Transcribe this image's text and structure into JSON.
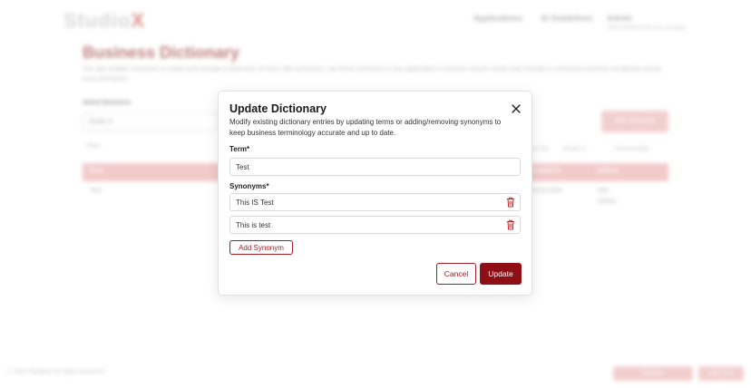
{
  "background": {
    "logo_text": "Studio",
    "logo_x": "X",
    "nav": [
      "Applications",
      "AI Guidelines",
      "Admin"
    ],
    "user_sub": "someone@domain.com manage",
    "page_title": "Business Dictionary",
    "page_desc": "The app enables everyone to create and manage a dictionary of terms with synonyms, use these synonyms in any application to improve search results and maintain a consistent business vocabulary across tools and teams.",
    "select_label": "Select Business",
    "select_value": "Studio X",
    "add_button": "Add Dictionary",
    "filter_text": "Filter",
    "sort_by": "Sort By",
    "sort_value": "Studio X",
    "sort_order": "Descending",
    "table_headers": [
      "Term",
      "Created At",
      "Actions"
    ],
    "row": {
      "term": "Test",
      "created": "01/01/2024",
      "action1": "Edit",
      "action2": "Delete"
    },
    "footer": "© 2024 StudioX All rights reserved.",
    "footer_btn1": "Explore",
    "footer_btn2": "Sign Out"
  },
  "modal": {
    "title": "Update Dictionary",
    "description": "Modify existing dictionary entries by updating terms or adding/removing synonyms to keep business terminology accurate and up to date.",
    "term_label": "Term*",
    "term_value": "Test",
    "synonyms_label": "Synonyms*",
    "synonyms": [
      {
        "value": "This IS Test"
      },
      {
        "value": "This is test"
      }
    ],
    "add_synonym_label": "Add Synonym",
    "cancel_label": "Cancel",
    "update_label": "Update"
  },
  "colors": {
    "accent": "#a31d24",
    "primary_button": "#8e1016",
    "trash": "#c0282e"
  },
  "icons": {
    "close": "close-icon",
    "trash": "trash-icon"
  }
}
